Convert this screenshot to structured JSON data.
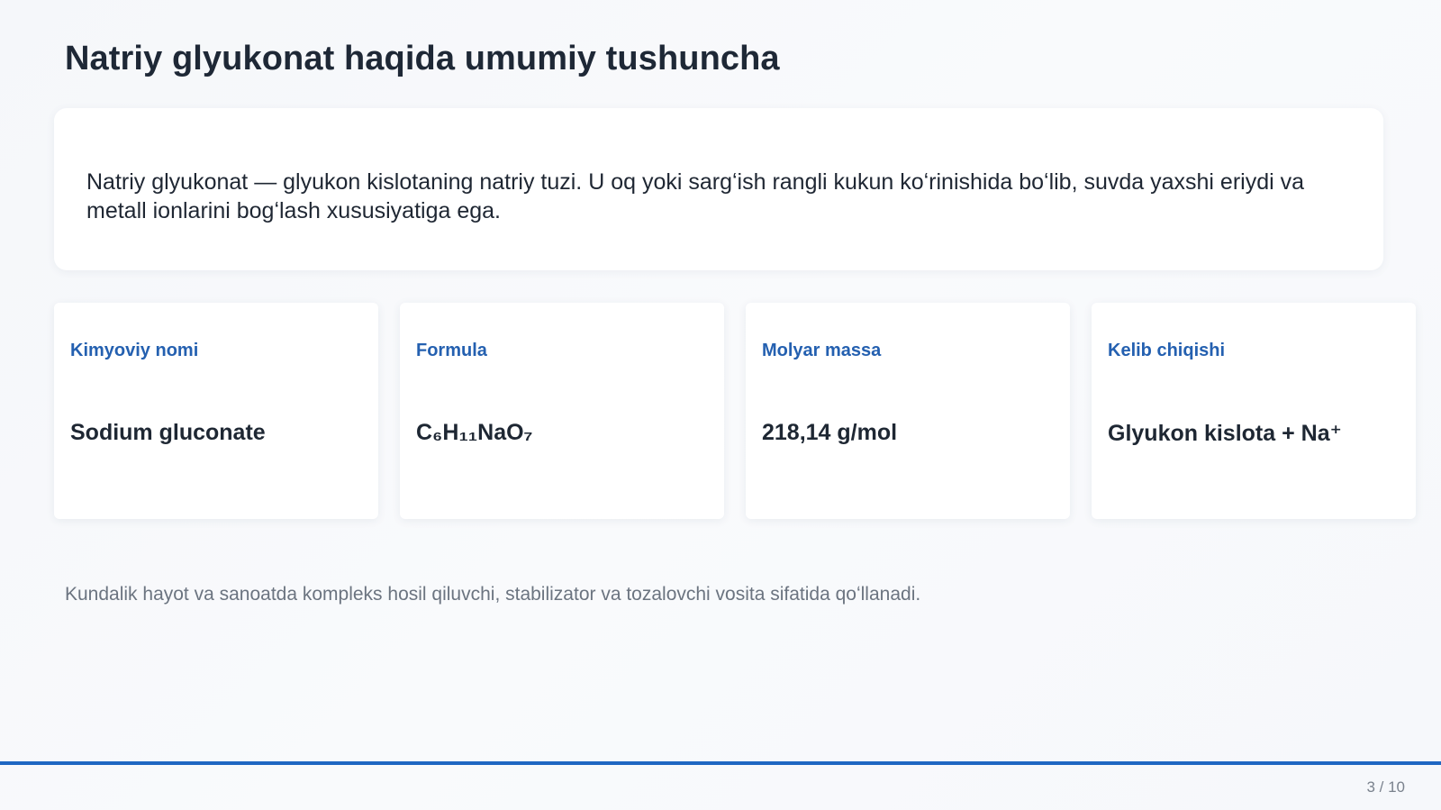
{
  "slide": {
    "title": "Natriy glyukonat haqida umumiy tushuncha",
    "intro": "Natriy glyukonat — glyukon kislotaning natriy tuzi. U oq yoki sargʻish rangli kukun koʻrinishida boʻlib, suvda yaxshi eriydi va metall ionlarini bogʻlash xususiyatiga ega.",
    "cards": [
      {
        "label": "Kimyoviy nomi",
        "value": "Sodium gluconate"
      },
      {
        "label": "Formula",
        "value": "C₆H₁₁NaO₇"
      },
      {
        "label": "Molyar massa",
        "value": "218,14 g/mol"
      },
      {
        "label": "Kelib chiqishi",
        "value": "Glyukon kislota + Na⁺"
      }
    ],
    "footnote": "Kundalik hayot va sanoatda kompleks hosil qiluvchi, stabilizator va tozalovchi vosita sifatida qoʻllanadi.",
    "page_number": "3 / 10"
  },
  "colors": {
    "accent": "#1f67c2",
    "label": "#2460b0",
    "title": "#1e2836",
    "muted": "#6b7480"
  }
}
